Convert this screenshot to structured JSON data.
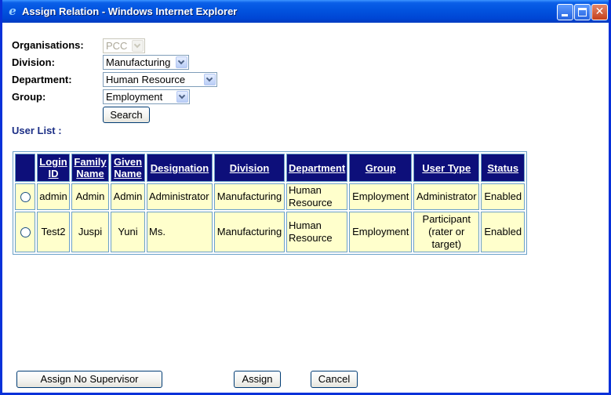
{
  "window": {
    "title": "Assign Relation - Windows Internet Explorer",
    "icon": "ie-icon",
    "controls": {
      "close_glyph": "✕"
    }
  },
  "form": {
    "organisations": {
      "label": "Organisations:",
      "value": "PCC",
      "disabled": true
    },
    "division": {
      "label": "Division:",
      "value": "Manufacturing"
    },
    "department": {
      "label": "Department:",
      "value": "Human Resource"
    },
    "group": {
      "label": "Group:",
      "value": "Employment"
    },
    "search_label": "Search"
  },
  "user_list": {
    "label": "User List :",
    "columns": [
      "Login ID",
      "Family Name",
      "Given Name",
      "Designation",
      "Division",
      "Department",
      "Group",
      "User Type",
      "Status"
    ],
    "rows": [
      {
        "login_id": "admin",
        "family_name": "Admin",
        "given_name": "Admin",
        "designation": "Administrator",
        "division": "Manufacturing",
        "department": "Human Resource",
        "group": "Employment",
        "user_type": "Administrator",
        "status": "Enabled"
      },
      {
        "login_id": "Test2",
        "family_name": "Juspi",
        "given_name": "Yuni",
        "designation": "Ms.",
        "division": "Manufacturing",
        "department": "Human Resource",
        "group": "Employment",
        "user_type": "Participant (rater or target)",
        "status": "Enabled"
      }
    ]
  },
  "footer": {
    "assign_no_supervisor": "Assign No Supervisor",
    "assign": "Assign",
    "cancel": "Cancel"
  },
  "colors": {
    "titlebar": "#0255e0",
    "header_bg": "#0d0f7a",
    "cell_bg": "#ffffcc",
    "label_blue": "#1c2f86"
  }
}
